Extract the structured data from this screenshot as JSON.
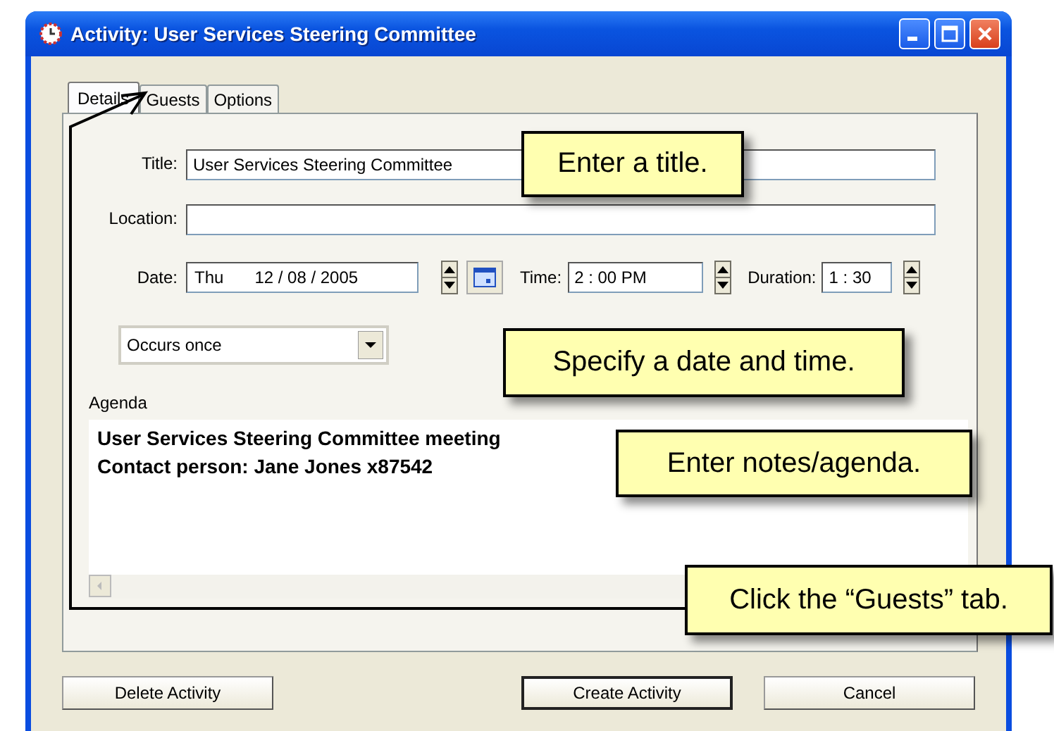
{
  "window": {
    "title": "Activity: User Services Steering Committee"
  },
  "tabs": [
    {
      "label": "Details",
      "selected": true
    },
    {
      "label": "Guests",
      "selected": false
    },
    {
      "label": "Options",
      "selected": false
    }
  ],
  "title_field": {
    "label": "Title:",
    "value": "User Services Steering Committee"
  },
  "location_field": {
    "label": "Location:"
  },
  "date_field": {
    "label": "Date:",
    "day": "Thu",
    "value": "12 / 08 / 2005"
  },
  "time_field": {
    "label": "Time:",
    "value": "2  : 00 PM"
  },
  "duration_field": {
    "label": "Duration:",
    "value": "1  : 30"
  },
  "recurrence": {
    "value": "Occurs once"
  },
  "agenda": {
    "label": "Agenda",
    "lines": [
      "User Services Steering Committee meeting",
      "Contact person:  Jane Jones x87542"
    ]
  },
  "buttons": [
    {
      "label": "Delete Activity",
      "default": false
    },
    {
      "label": "Create Activity",
      "default": true
    },
    {
      "label": "Cancel",
      "default": false
    }
  ],
  "callouts": [
    {
      "text": "Enter a title."
    },
    {
      "text": "Specify a date and time."
    },
    {
      "text": "Enter notes/agenda."
    },
    {
      "text": "Click the “Guests” tab."
    }
  ]
}
